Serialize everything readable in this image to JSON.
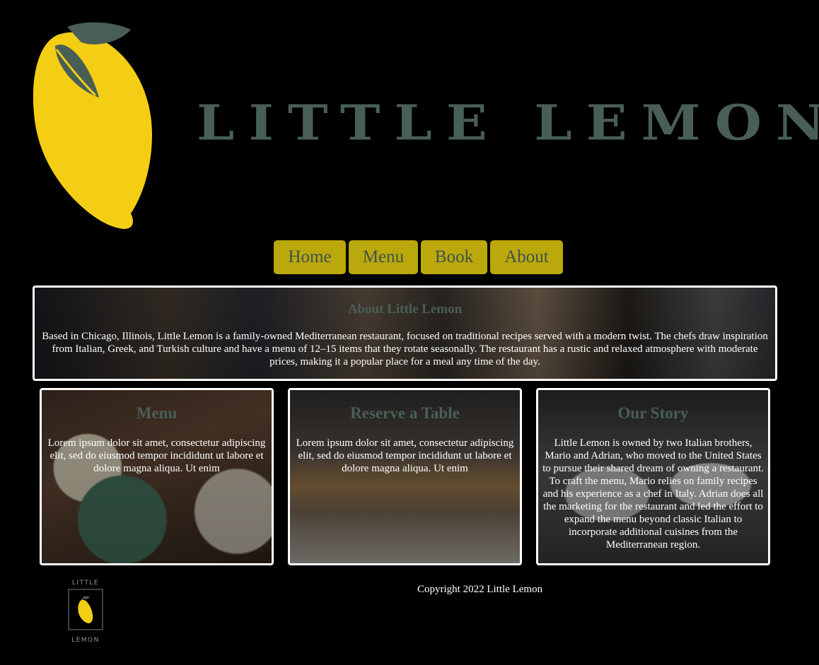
{
  "header": {
    "brand_name": "LITTLE LEMON",
    "logo_icon": "lemon-icon"
  },
  "nav": {
    "items": [
      {
        "label": "Home"
      },
      {
        "label": "Menu"
      },
      {
        "label": "Book"
      },
      {
        "label": "About"
      }
    ]
  },
  "about": {
    "title": "About Little Lemon",
    "body": "Based in Chicago, Illinois, Little Lemon is a family-owned Mediterranean restaurant, focused on traditional recipes served with a modern twist. The chefs draw inspiration from Italian, Greek, and Turkish culture and have a menu of 12–15 items that they rotate seasonally. The restaurant has a rustic and relaxed atmosphere with moderate prices, making it a popular place for a meal any time of the day."
  },
  "features": [
    {
      "title": "Menu",
      "body": "Lorem ipsum dolor sit amet, consectetur adipiscing elit, sed do eiusmod tempor incididunt ut labore et dolore magna aliqua. Ut enim"
    },
    {
      "title": "Reserve a Table",
      "body": "Lorem ipsum dolor sit amet, consectetur adipiscing elit, sed do eiusmod tempor incididunt ut labore et dolore magna aliqua. Ut enim"
    },
    {
      "title": "Our Story",
      "body": "Little Lemon is owned by two Italian brothers, Mario and Adrian, who moved to the United States to pursue their shared dream of owning a restaurant. To craft the menu, Mario relies on family recipes and his experience as a chef in Italy. Adrian does all the marketing for the restaurant and led the effort to expand the menu beyond classic Italian to incorporate additional cuisines from the Mediterranean region."
    }
  ],
  "footer": {
    "logo_top": "LITTLE",
    "logo_bottom": "LEMON",
    "copyright": "Copyright 2022 Little Lemon"
  },
  "colors": {
    "background": "#000000",
    "brand_green": "#495e57",
    "lemon_yellow": "#f4ce14",
    "nav_yellow": "#d4c00e",
    "text": "#ffffff"
  }
}
